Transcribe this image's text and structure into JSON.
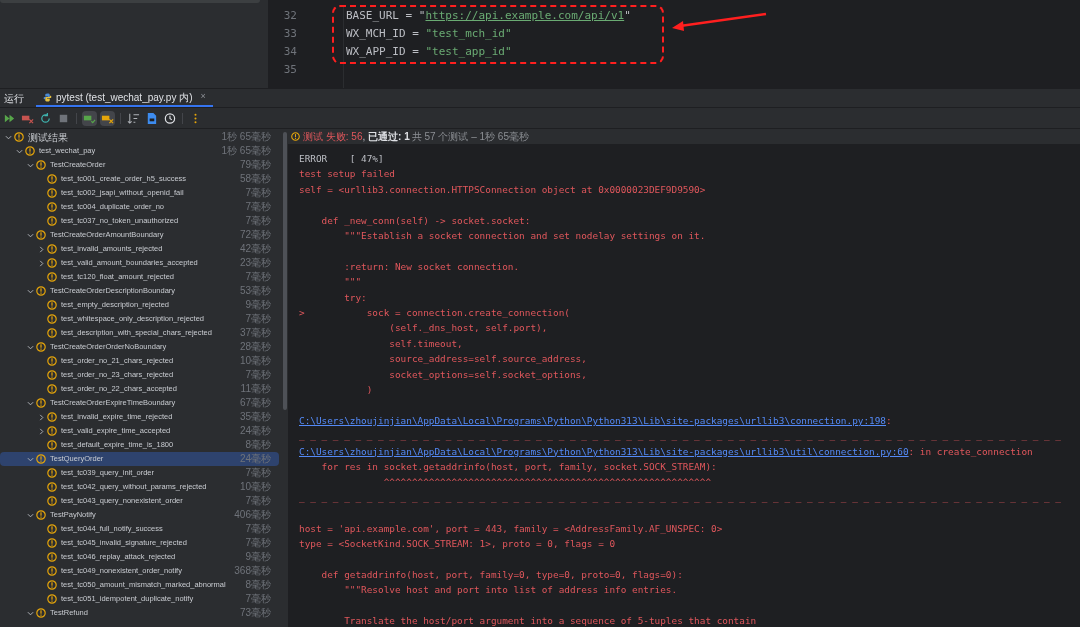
{
  "editor": {
    "line_numbers": [
      "32",
      "33",
      "34",
      "35"
    ],
    "code_lines": [
      [
        {
          "kind": "plain",
          "text": "BASE_URL = "
        },
        {
          "kind": "quote",
          "text": "\""
        },
        {
          "kind": "url",
          "text": "https://api.example.com/api/v1"
        },
        {
          "kind": "quote",
          "text": "\""
        }
      ],
      [
        {
          "kind": "plain",
          "text": "WX_MCH_ID = "
        },
        {
          "kind": "string",
          "text": "\"test_mch_id\""
        }
      ],
      [
        {
          "kind": "plain",
          "text": "WX_APP_ID = "
        },
        {
          "kind": "string",
          "text": "\"test_app_id\""
        }
      ]
    ]
  },
  "run_panel": {
    "label": "运行",
    "tabs": [
      {
        "title": "pytest (test_wechat_pay.py 内)",
        "close": "×",
        "selected": true
      }
    ],
    "toolbar": [
      {
        "kind": "run-all"
      },
      {
        "kind": "rerun-failed"
      },
      {
        "kind": "refresh"
      },
      {
        "kind": "stop"
      },
      {
        "kind": "show-passed",
        "selected": true
      },
      {
        "kind": "show-ignored",
        "selected": true
      },
      {
        "kind": "sort"
      },
      {
        "kind": "export"
      },
      {
        "kind": "history"
      },
      {
        "kind": "more"
      }
    ]
  },
  "tree": [
    {
      "label": "测试结果",
      "time": "1秒 65毫秒",
      "expanded": true,
      "selected": false,
      "children": [
        {
          "label": "test_wechat_pay",
          "time": "1秒 65毫秒",
          "expanded": true,
          "selected": false,
          "children": [
            {
              "label": "TestCreateOrder",
              "time": "79毫秒",
              "expanded": true,
              "selected": false,
              "children": [
                {
                  "label": "test_tc001_create_order_h5_success",
                  "time": "58毫秒",
                  "selected": false
                },
                {
                  "label": "test_tc002_jsapi_without_openid_fail",
                  "time": "7毫秒",
                  "selected": false
                },
                {
                  "label": "test_tc004_duplicate_order_no",
                  "time": "7毫秒",
                  "selected": false
                },
                {
                  "label": "test_tc037_no_token_unauthorized",
                  "time": "7毫秒",
                  "selected": false
                }
              ]
            },
            {
              "label": "TestCreateOrderAmountBoundary",
              "time": "72毫秒",
              "expanded": true,
              "selected": false,
              "children": [
                {
                  "label": "test_invalid_amounts_rejected",
                  "time": "42毫秒",
                  "expanded": false,
                  "selected": false
                },
                {
                  "label": "test_valid_amount_boundaries_accepted",
                  "time": "23毫秒",
                  "expanded": false,
                  "selected": false
                },
                {
                  "label": "test_tc120_float_amount_rejected",
                  "time": "7毫秒",
                  "selected": false
                }
              ]
            },
            {
              "label": "TestCreateOrderDescriptionBoundary",
              "time": "53毫秒",
              "expanded": true,
              "selected": false,
              "children": [
                {
                  "label": "test_empty_description_rejected",
                  "time": "9毫秒",
                  "selected": false
                },
                {
                  "label": "test_whitespace_only_description_rejected",
                  "time": "7毫秒",
                  "selected": false
                },
                {
                  "label": "test_description_with_special_chars_rejected",
                  "time": "37毫秒",
                  "selected": false
                }
              ]
            },
            {
              "label": "TestCreateOrderOrderNoBoundary",
              "time": "28毫秒",
              "expanded": true,
              "selected": false,
              "children": [
                {
                  "label": "test_order_no_21_chars_rejected",
                  "time": "10毫秒",
                  "selected": false
                },
                {
                  "label": "test_order_no_23_chars_rejected",
                  "time": "7毫秒",
                  "selected": false
                },
                {
                  "label": "test_order_no_22_chars_accepted",
                  "time": "11毫秒",
                  "selected": false
                }
              ]
            },
            {
              "label": "TestCreateOrderExpireTimeBoundary",
              "time": "67毫秒",
              "expanded": true,
              "selected": false,
              "children": [
                {
                  "label": "test_invalid_expire_time_rejected",
                  "time": "35毫秒",
                  "expanded": false,
                  "selected": false
                },
                {
                  "label": "test_valid_expire_time_accepted",
                  "time": "24毫秒",
                  "expanded": false,
                  "selected": false
                },
                {
                  "label": "test_default_expire_time_is_1800",
                  "time": "8毫秒",
                  "selected": false
                }
              ]
            },
            {
              "label": "TestQueryOrder",
              "time": "24毫秒",
              "expanded": true,
              "selected": true,
              "children": [
                {
                  "label": "test_tc039_query_init_order",
                  "time": "7毫秒",
                  "selected": false
                },
                {
                  "label": "test_tc042_query_without_params_rejected",
                  "time": "10毫秒",
                  "selected": false
                },
                {
                  "label": "test_tc043_query_nonexistent_order",
                  "time": "7毫秒",
                  "selected": false
                }
              ]
            },
            {
              "label": "TestPayNotify",
              "time": "406毫秒",
              "expanded": true,
              "selected": false,
              "children": [
                {
                  "label": "test_tc044_full_notify_success",
                  "time": "7毫秒",
                  "selected": false
                },
                {
                  "label": "test_tc045_invalid_signature_rejected",
                  "time": "7毫秒",
                  "selected": false
                },
                {
                  "label": "test_tc046_replay_attack_rejected",
                  "time": "9毫秒",
                  "selected": false
                },
                {
                  "label": "test_tc049_nonexistent_order_notify",
                  "time": "368毫秒",
                  "selected": false
                },
                {
                  "label": "test_tc050_amount_mismatch_marked_abnormal",
                  "time": "8毫秒",
                  "selected": false
                },
                {
                  "label": "test_tc051_idempotent_duplicate_notify",
                  "time": "7毫秒",
                  "selected": false
                }
              ]
            },
            {
              "label": "TestRefund",
              "time": "73毫秒",
              "expanded": true,
              "selected": false
            }
          ]
        }
      ]
    }
  ],
  "summary": [
    {
      "kind": "fail",
      "text": "测试 失败: 56"
    },
    {
      "kind": "plain",
      "text": ", "
    },
    {
      "kind": "pass",
      "text": "已通过: 1"
    },
    {
      "kind": "muted",
      "text": "共 57 个测试 – 1秒 65毫秒"
    }
  ],
  "console": [
    {
      "kind": "plain",
      "text": "ERROR    [ 47%]"
    },
    {
      "kind": "error",
      "text": "test setup failed"
    },
    {
      "kind": "error",
      "text": "self = <urllib3.connection.HTTPSConnection object at 0x0000023DEF9D9590>"
    },
    {
      "kind": "blank"
    },
    {
      "kind": "error",
      "text": "    def _new_conn(self) -> socket.socket:"
    },
    {
      "kind": "error",
      "text": "        \"\"\"Establish a socket connection and set nodelay settings on it."
    },
    {
      "kind": "blank"
    },
    {
      "kind": "error",
      "text": "        :return: New socket connection."
    },
    {
      "kind": "error",
      "text": "        \"\"\""
    },
    {
      "kind": "error",
      "text": "        try:"
    },
    {
      "kind": "error",
      "text": ">           sock = connection.create_connection("
    },
    {
      "kind": "error",
      "text": "                (self._dns_host, self.port),"
    },
    {
      "kind": "error",
      "text": "                self.timeout,"
    },
    {
      "kind": "error",
      "text": "                source_address=self.source_address,"
    },
    {
      "kind": "error",
      "text": "                socket_options=self.socket_options,"
    },
    {
      "kind": "error",
      "text": "            )"
    },
    {
      "kind": "blank"
    },
    {
      "kind": "link",
      "text": "C:\\Users\\zhoujinjian\\AppData\\Local\\Programs\\Python\\Python313\\Lib\\site-packages\\urllib3\\connection.py:198",
      "rest": ":"
    },
    {
      "kind": "error",
      "text": "_ _ _ _ _ _ _ _ _ _ _ _ _ _ _ _ _ _ _ _ _ _ _ _ _ _ _ _ _ _ _ _ _ _ _ _ _ _ _ _ _ _ _ _ _ _ _ _ _ _ _ _ _ _ _ _ _ _ _ _ _ _ _ _ _ _ _ _"
    },
    {
      "kind": "link",
      "text": "C:\\Users\\zhoujinjian\\AppData\\Local\\Programs\\Python\\Python313\\Lib\\site-packages\\urllib3\\util\\connection.py:60",
      "rest": ": in create_connection"
    },
    {
      "kind": "error",
      "text": "    for res in socket.getaddrinfo(host, port, family, socket.SOCK_STREAM):"
    },
    {
      "kind": "error",
      "text": "               ^^^^^^^^^^^^^^^^^^^^^^^^^^^^^^^^^^^^^^^^^^^^^^^^^^^^^^^^^^"
    },
    {
      "kind": "error",
      "text": "_ _ _ _ _ _ _ _ _ _ _ _ _ _ _ _ _ _ _ _ _ _ _ _ _ _ _ _ _ _ _ _ _ _ _ _ _ _ _ _ _ _ _ _ _ _ _ _ _ _ _ _ _ _ _ _ _ _ _ _ _ _ _ _ _ _ _ _"
    },
    {
      "kind": "blank"
    },
    {
      "kind": "error",
      "text": "host = 'api.example.com', port = 443, family = <AddressFamily.AF_UNSPEC: 0>"
    },
    {
      "kind": "error",
      "text": "type = <SocketKind.SOCK_STREAM: 1>, proto = 0, flags = 0"
    },
    {
      "kind": "blank"
    },
    {
      "kind": "error",
      "text": "    def getaddrinfo(host, port, family=0, type=0, proto=0, flags=0):"
    },
    {
      "kind": "error",
      "text": "        \"\"\"Resolve host and port into list of address info entries."
    },
    {
      "kind": "blank"
    },
    {
      "kind": "error",
      "text": "        Translate the host/port argument into a sequence of 5-tuples that contain"
    }
  ]
}
